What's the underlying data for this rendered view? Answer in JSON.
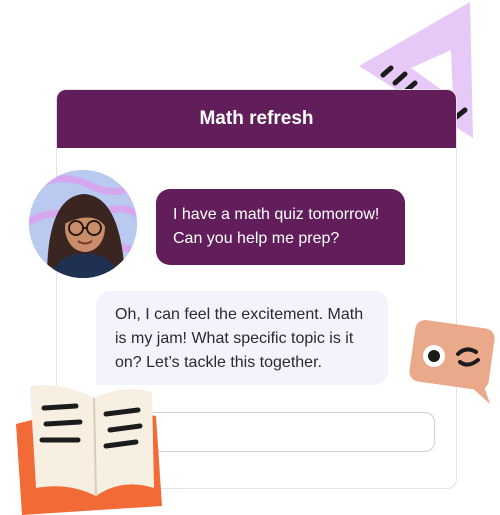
{
  "chat": {
    "title": "Math refresh",
    "messages": [
      {
        "role": "user",
        "text": "I have a math quiz tomorrow! Can you help me prep?"
      },
      {
        "role": "assistant",
        "text": "Oh, I can feel the excitement. Math is my jam! What specific topic is it on? Let’s tackle this together."
      }
    ],
    "input_value": ""
  },
  "icons": {
    "ruler": "triangle-ruler-icon",
    "book": "open-book-icon",
    "wink": "wink-face-icon",
    "avatar": "user-avatar"
  },
  "colors": {
    "header": "#621e5b",
    "user_bubble": "#621e5b",
    "assistant_bubble": "#f4f2fb",
    "ruler": "#e7c9f7",
    "book_cover": "#f26a35",
    "book_pages": "#f6efe2",
    "wink_tile": "#e9a98a"
  }
}
